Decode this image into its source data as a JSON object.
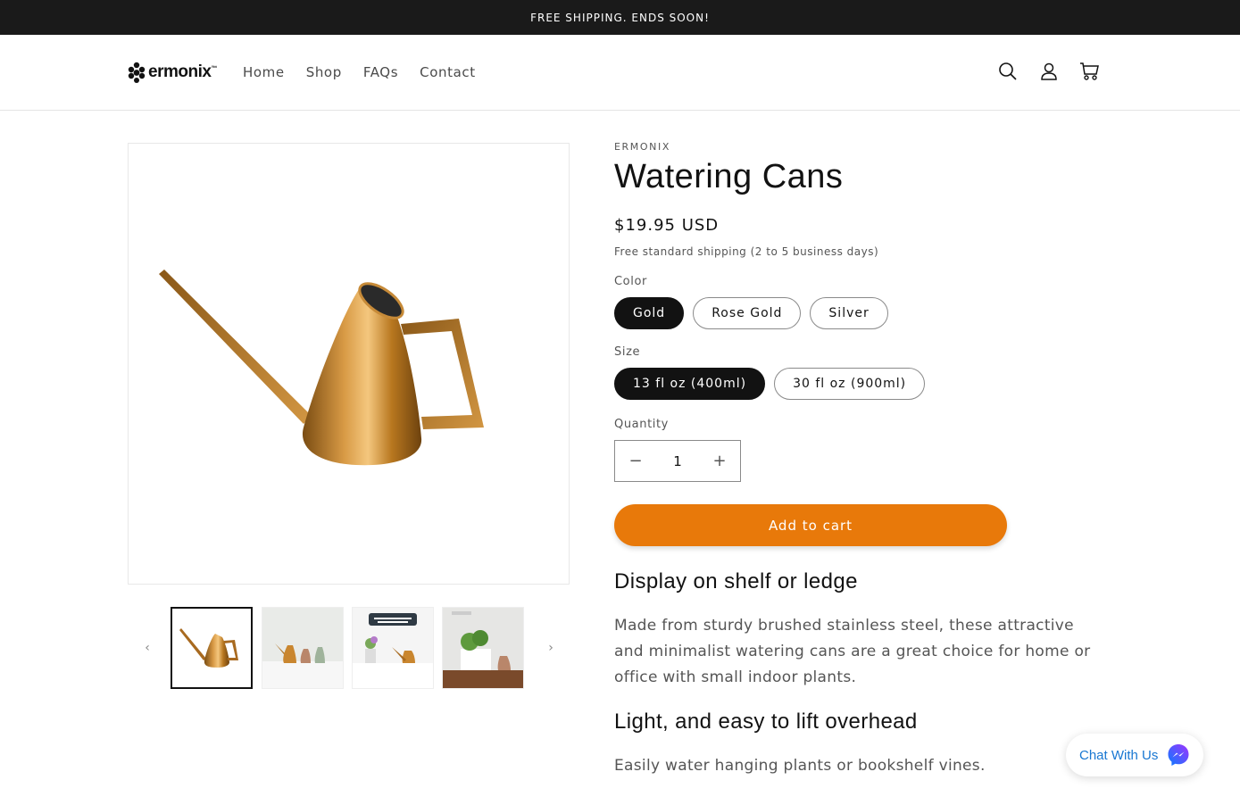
{
  "announcement": "FREE SHIPPING. ENDS SOON!",
  "brand": {
    "name": "ermonix",
    "tm": "™"
  },
  "nav": [
    "Home",
    "Shop",
    "FAQs",
    "Contact"
  ],
  "header_icons": [
    "search-icon",
    "account-icon",
    "cart-icon"
  ],
  "product": {
    "vendor": "ERMONIX",
    "title": "Watering Cans",
    "price": "$19.95 USD",
    "shipping_note": "Free standard shipping (2 to 5 business days)",
    "color_label": "Color",
    "colors": [
      "Gold",
      "Rose Gold",
      "Silver"
    ],
    "selected_color": "Gold",
    "size_label": "Size",
    "sizes": [
      "13 fl oz (400ml)",
      "30 fl oz (900ml)"
    ],
    "selected_size": "13 fl oz (400ml)",
    "quantity_label": "Quantity",
    "quantity": "1",
    "qty_minus": "−",
    "qty_plus": "+",
    "add_to_cart": "Add to cart",
    "sections": [
      {
        "heading": "Display on shelf or ledge",
        "body": "Made from sturdy brushed stainless steel, these attractive and minimalist watering cans are a great choice for home or office with small indoor plants."
      },
      {
        "heading": "Light, and easy to lift overhead",
        "body": "Easily water hanging plants or bookshelf vines."
      }
    ]
  },
  "gallery": {
    "prev_arrow": "‹",
    "next_arrow": "›",
    "thumb3_caption": "Minimalist design. Perfect for home or office."
  },
  "chat": {
    "label": "Chat With Us"
  },
  "colors": {
    "accent": "#e8790a",
    "dark": "#121212",
    "chat_blue": "#1877d2",
    "gold": "#c9862f"
  }
}
